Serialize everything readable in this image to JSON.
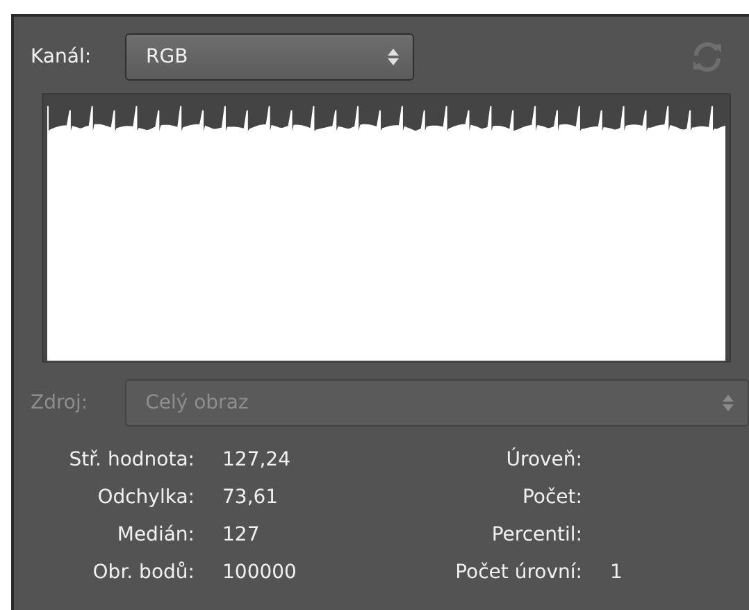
{
  "channel": {
    "label": "Kanál:",
    "value": "RGB"
  },
  "source": {
    "label": "Zdroj:",
    "value": "Celý obraz",
    "disabled": true
  },
  "stats_left": [
    {
      "label": "Stř. hodnota:",
      "value": "127,24"
    },
    {
      "label": "Odchylka:",
      "value": "73,61"
    },
    {
      "label": "Medián:",
      "value": "127"
    },
    {
      "label": "Obr. bodů:",
      "value": "100000"
    }
  ],
  "stats_right": [
    {
      "label": "Úroveň:"
    },
    {
      "label": "Počet:"
    },
    {
      "label": "Percentil:"
    },
    {
      "label": "Počet úrovní:",
      "value": "1"
    }
  ]
}
